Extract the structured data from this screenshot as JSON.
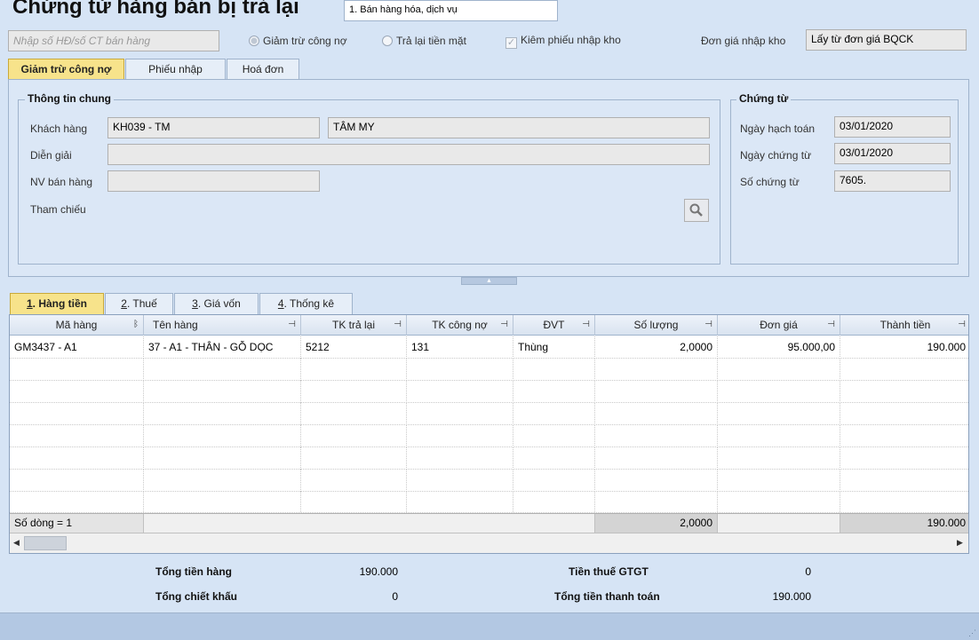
{
  "title": "Chứng từ hàng bán bị trả lại",
  "sale_type": "1. Bán hàng hóa, dịch vụ",
  "search_placeholder": "Nhập số HĐ/số CT bán hàng",
  "options": {
    "radio_reduce_debt": "Giảm trừ công nợ",
    "radio_cash_refund": "Trả lại tiền mặt",
    "check_receipt": "Kiêm phiếu nhập kho",
    "unit_price_label": "Đơn giá nhập kho",
    "unit_price_value": "Lấy từ đơn giá BQCK"
  },
  "top_tabs": [
    {
      "label": "Giảm trừ công nợ",
      "active": true
    },
    {
      "label": "Phiếu nhập",
      "active": false
    },
    {
      "label": "Hoá đơn",
      "active": false
    }
  ],
  "general": {
    "legend": "Thông tin chung",
    "customer_label": "Khách hàng",
    "customer_code": "KH039 - TM",
    "customer_name": "TÂM MY",
    "description_label": "Diễn giải",
    "description_value": "",
    "salesperson_label": "NV bán hàng",
    "salesperson_value": "",
    "reference_label": "Tham chiếu"
  },
  "voucher": {
    "legend": "Chứng từ",
    "posting_date_label": "Ngày hạch toán",
    "posting_date": "03/01/2020",
    "voucher_date_label": "Ngày chứng từ",
    "voucher_date": "03/01/2020",
    "voucher_no_label": "Số chứng từ",
    "voucher_no": "7605."
  },
  "grid_tabs": [
    {
      "num": "1",
      "label": ". Hàng tiền",
      "active": true
    },
    {
      "num": "2",
      "label": ". Thuế",
      "active": false
    },
    {
      "num": "3",
      "label": ". Giá vốn",
      "active": false
    },
    {
      "num": "4",
      "label": ". Thống kê",
      "active": false
    }
  ],
  "columns": [
    "Mã hàng",
    "Tên hàng",
    "TK trả lại",
    "TK công nợ",
    "ĐVT",
    "Số lượng",
    "Đơn giá",
    "Thành tiền"
  ],
  "rows": [
    {
      "code": "GM3437 - A1",
      "name": "37 - A1 - THÂN - GỖ DỌC",
      "return_acct": "5212",
      "debt_acct": "131",
      "unit": "Thùng",
      "qty": "2,0000",
      "price": "95.000,00",
      "amount": "190.000"
    }
  ],
  "footer": {
    "row_count": "Số dòng = 1",
    "qty_total": "2,0000",
    "amount_total": "190.000"
  },
  "summary": {
    "goods_total_label": "Tổng tiền hàng",
    "goods_total": "190.000",
    "discount_label": "Tổng chiết khấu",
    "discount": "0",
    "vat_label": "Tiền thuế GTGT",
    "vat": "0",
    "payment_label": "Tổng tiền thanh toán",
    "payment": "190.000"
  }
}
